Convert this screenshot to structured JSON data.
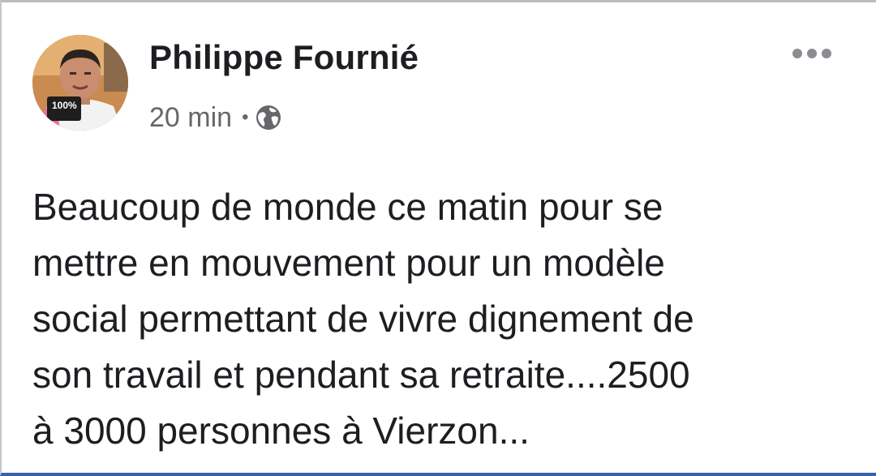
{
  "post": {
    "author": "Philippe Fournié",
    "timestamp": "20 min",
    "separator": "•",
    "privacy_icon": "globe-icon",
    "more_icon": "more-options-icon",
    "avatar_badge": "100%",
    "text_lines": [
      "Beaucoup de monde ce matin pour se",
      "mettre en mouvement pour un modèle",
      "social permettant de vivre dignement de",
      "son travail et pendant sa retraite....2500",
      "à 3000 personnes à Vierzon..."
    ]
  },
  "colors": {
    "author_text": "#1c1e21",
    "meta_text": "#65676b",
    "bottom_border": "#3b5fa8"
  }
}
